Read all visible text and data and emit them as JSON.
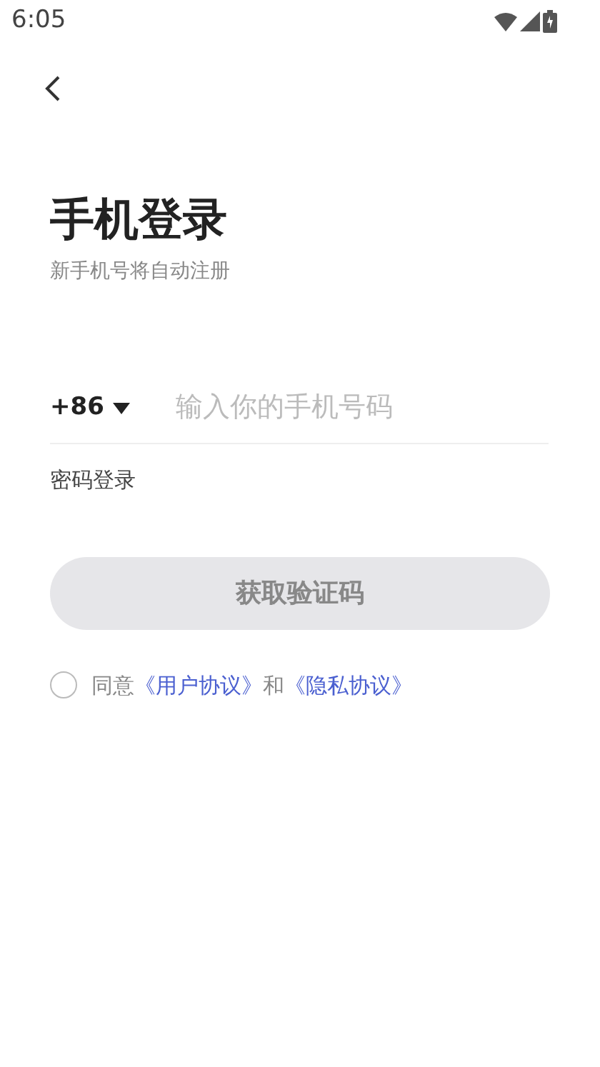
{
  "status_bar": {
    "time": "6:05"
  },
  "title": "手机登录",
  "subtitle": "新手机号将自动注册",
  "phone": {
    "country_code": "+86",
    "placeholder": "输入你的手机号码"
  },
  "password_login": "密码登录",
  "submit_button": {
    "label": "获取验证码",
    "disabled": true
  },
  "agreement": {
    "checked": false,
    "parts": [
      {
        "kind": "text",
        "text": "同意"
      },
      {
        "kind": "link",
        "text": "《用户协议》"
      },
      {
        "kind": "text",
        "text": "和"
      },
      {
        "kind": "link",
        "text": "《隐私协议》"
      }
    ]
  }
}
